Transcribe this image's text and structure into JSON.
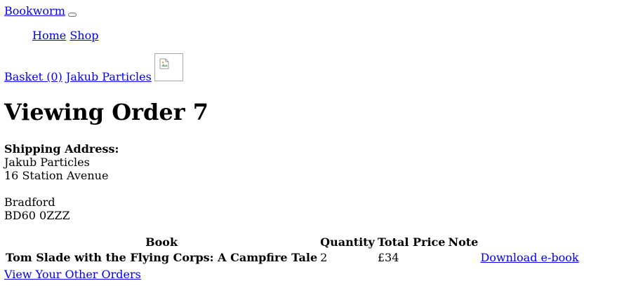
{
  "header": {
    "brand": "Bookworm"
  },
  "nav": {
    "home": "Home",
    "shop": "Shop"
  },
  "user_bar": {
    "basket": "Basket (0)",
    "user_name": "Jakub Particles"
  },
  "page": {
    "title": "Viewing Order 7"
  },
  "shipping": {
    "label": "Shipping Address:",
    "lines": [
      "Jakub Particles",
      "16 Station Avenue",
      "",
      "Bradford",
      "BD60 0ZZZ"
    ]
  },
  "order_table": {
    "headers": {
      "book": "Book",
      "quantity": "Quantity",
      "total_price": "Total Price",
      "note": "Note"
    },
    "rows": [
      {
        "book": "Tom Slade with the Flying Corps: A Campfire Tale",
        "quantity": "2",
        "total_price": "£34",
        "note_link": "Download e-book"
      }
    ]
  },
  "footer_link": "View Your Other Orders",
  "colors": {
    "link": "#0000ee",
    "text": "#000000",
    "background": "#ffffff"
  },
  "icons": {
    "avatar": "broken-image-icon",
    "menu_toggle": "menu-toggle-button"
  }
}
